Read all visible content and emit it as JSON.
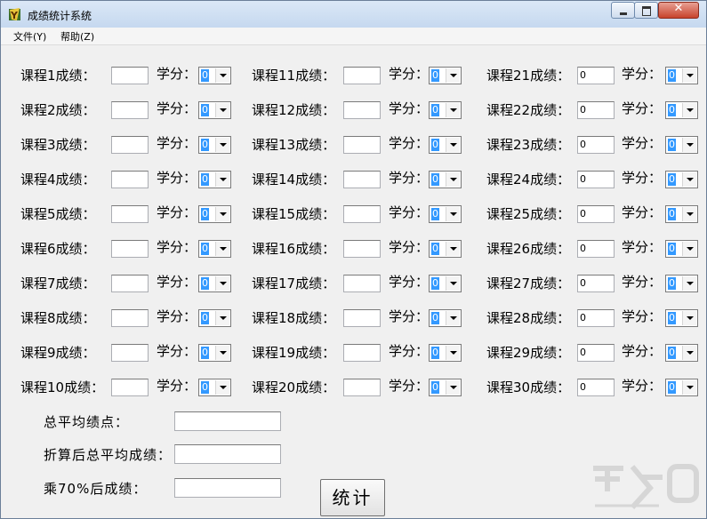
{
  "window": {
    "title": "成绩统计系统"
  },
  "menu": [
    {
      "label": "文件(Y)"
    },
    {
      "label": "帮助(Z)"
    }
  ],
  "credit_label": "学分：",
  "credit_default": "0",
  "courses": [
    {
      "label": "课程1成绩：",
      "score": ""
    },
    {
      "label": "课程2成绩：",
      "score": ""
    },
    {
      "label": "课程3成绩：",
      "score": ""
    },
    {
      "label": "课程4成绩：",
      "score": ""
    },
    {
      "label": "课程5成绩：",
      "score": ""
    },
    {
      "label": "课程6成绩：",
      "score": ""
    },
    {
      "label": "课程7成绩：",
      "score": ""
    },
    {
      "label": "课程8成绩：",
      "score": ""
    },
    {
      "label": "课程9成绩：",
      "score": ""
    },
    {
      "label": "课程10成绩：",
      "score": ""
    },
    {
      "label": "课程11成绩：",
      "score": ""
    },
    {
      "label": "课程12成绩：",
      "score": ""
    },
    {
      "label": "课程13成绩：",
      "score": ""
    },
    {
      "label": "课程14成绩：",
      "score": ""
    },
    {
      "label": "课程15成绩：",
      "score": ""
    },
    {
      "label": "课程16成绩：",
      "score": ""
    },
    {
      "label": "课程17成绩：",
      "score": ""
    },
    {
      "label": "课程18成绩：",
      "score": ""
    },
    {
      "label": "课程19成绩：",
      "score": ""
    },
    {
      "label": "课程20成绩：",
      "score": ""
    },
    {
      "label": "课程21成绩：",
      "score": "0"
    },
    {
      "label": "课程22成绩：",
      "score": "0"
    },
    {
      "label": "课程23成绩：",
      "score": "0"
    },
    {
      "label": "课程24成绩：",
      "score": "0"
    },
    {
      "label": "课程25成绩：",
      "score": "0"
    },
    {
      "label": "课程26成绩：",
      "score": "0"
    },
    {
      "label": "课程27成绩：",
      "score": "0"
    },
    {
      "label": "课程28成绩：",
      "score": "0"
    },
    {
      "label": "课程29成绩：",
      "score": "0"
    },
    {
      "label": "课程30成绩：",
      "score": "0"
    }
  ],
  "results": [
    {
      "label": "总平均绩点：",
      "value": ""
    },
    {
      "label": "折算后总平均成绩：",
      "value": ""
    },
    {
      "label": "乘70%后成绩：",
      "value": ""
    }
  ],
  "calc_button": "统计"
}
